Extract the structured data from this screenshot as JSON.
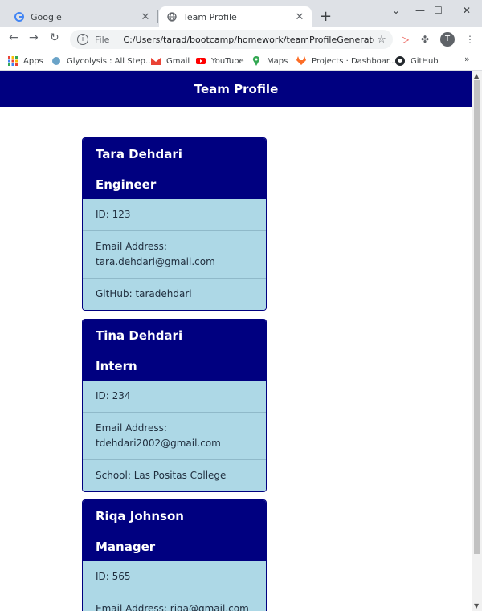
{
  "browser": {
    "tabs": [
      {
        "title": "Google",
        "active": false
      },
      {
        "title": "Team Profile",
        "active": true
      }
    ],
    "new_tab": "+",
    "url_scheme": "File",
    "url": "C:/Users/tarad/bootcamp/homework/teamProfileGenerator/o...",
    "avatar_letter": "T",
    "bookmarks": [
      "Apps",
      "Glycolysis : All Step...",
      "Gmail",
      "YouTube",
      "Maps",
      "Projects · Dashboar...",
      "GitHub"
    ],
    "bookmarks_more": "»"
  },
  "page": {
    "header_title": "Team Profile",
    "cards": [
      {
        "name": "Tara Dehdari",
        "role": "Engineer",
        "rows": [
          "ID: 123",
          "Email Address: tara.dehdari@gmail.com",
          "GitHub: taradehdari"
        ]
      },
      {
        "name": "Tina Dehdari",
        "role": "Intern",
        "rows": [
          "ID: 234",
          "Email Address: tdehdari2002@gmail.com",
          "School: Las Positas College"
        ]
      },
      {
        "name": "Riqa Johnson",
        "role": "Manager",
        "rows": [
          "ID: 565",
          "Email Address: riqa@gmail.com"
        ]
      }
    ]
  },
  "colors": {
    "header_bg": "#000080",
    "card_body": "#add8e6",
    "tabstrip": "#dee1e6"
  }
}
